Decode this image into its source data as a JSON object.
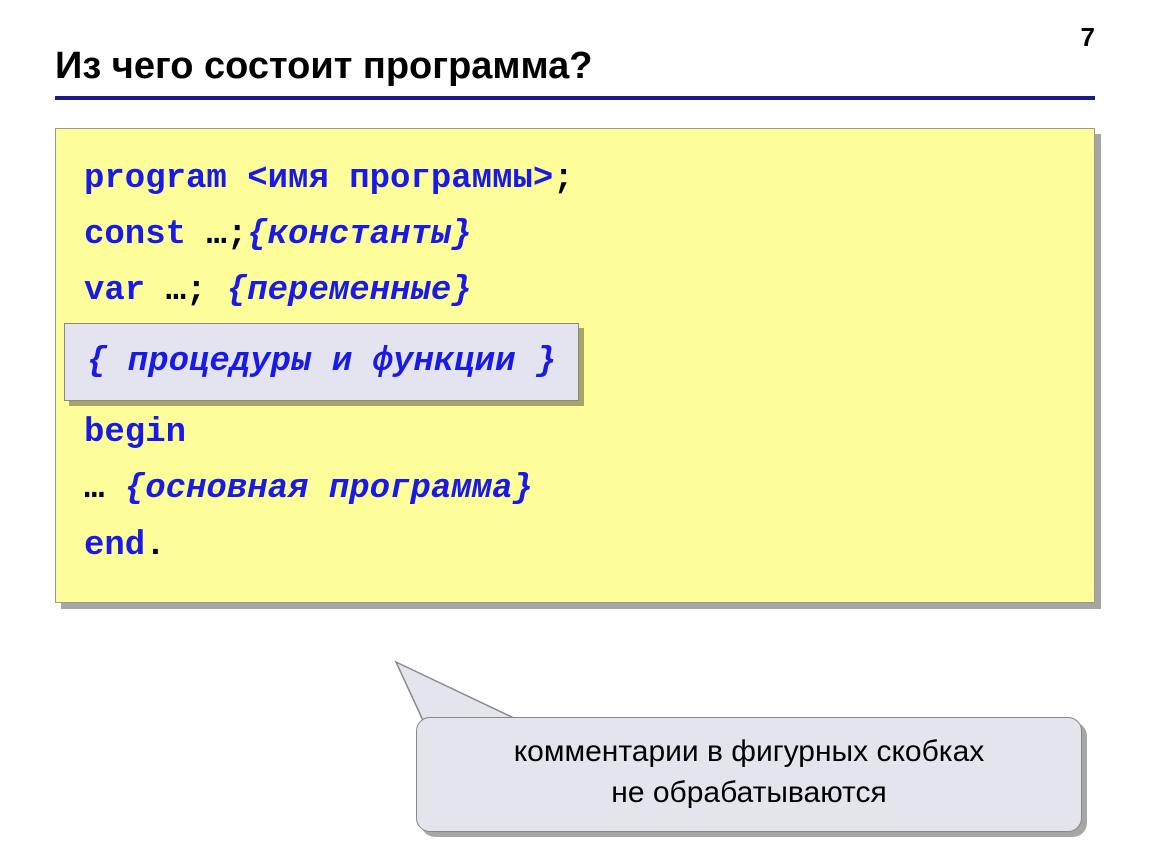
{
  "page_number": "7",
  "title": "Из чего состоит программа?",
  "code": {
    "l1_kw": "program",
    "l1_ph": " <имя программы>",
    "l1_sc": ";",
    "l2_kw": "const",
    "l2_rest": " …;",
    "l2_cmt": "{константы}",
    "l3_kw": "var",
    "l3_rest": " …; ",
    "l3_cmt": "{переменные}",
    "inner_cmt": "{ процедуры и функции }",
    "l5_kw": "begin",
    "l6_pre": " … ",
    "l6_cmt": "{основная программа}",
    "l7_kw": "end",
    "l7_dot": "."
  },
  "note_line1": "комментарии в фигурных скобках",
  "note_line2": "не обрабатываются"
}
